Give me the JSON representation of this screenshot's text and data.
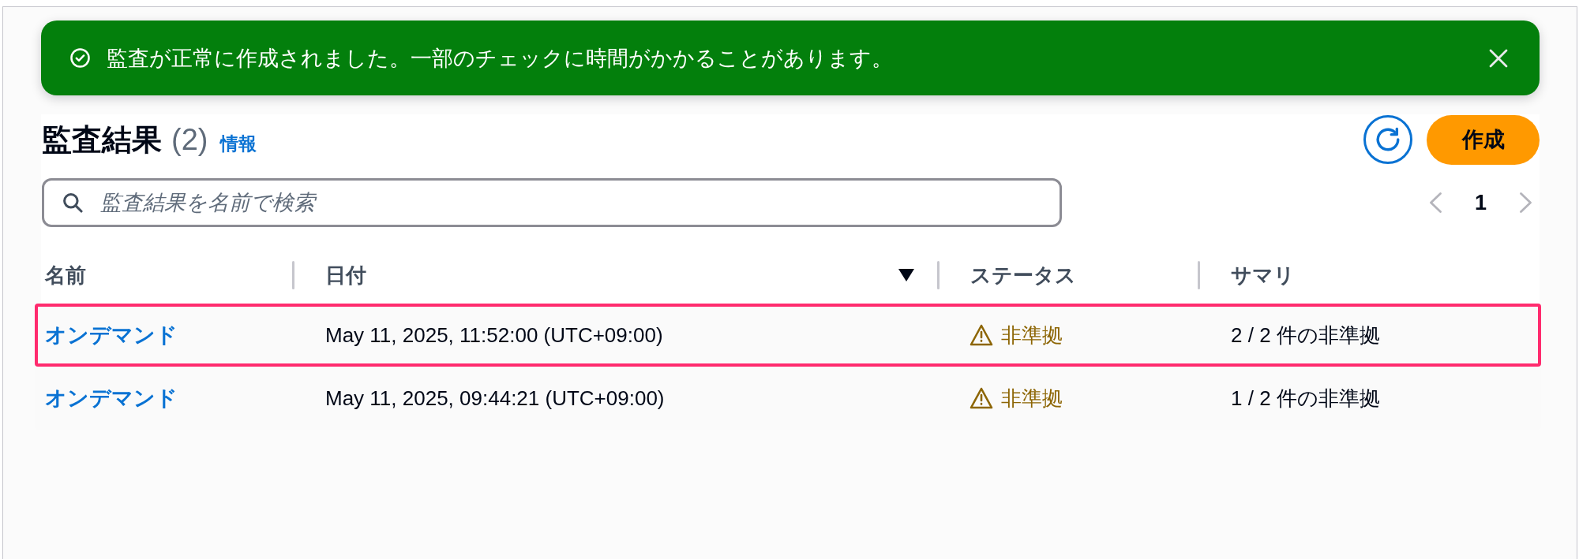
{
  "notifications": [
    {
      "kind": "success",
      "message": "監査が正常に作成されました。一部のチェックに時間がかかることがあります。",
      "dismissible": true
    }
  ],
  "header": {
    "title": "監査結果",
    "counter": "(2)",
    "info_link": "情報",
    "actions": [
      {
        "kind": "refresh"
      },
      {
        "kind": "primary",
        "label": "作成"
      }
    ]
  },
  "search": {
    "placeholder": "監査結果を名前で検索"
  },
  "pagination": {
    "previous": {
      "disabled": true
    },
    "pages": [
      {
        "label": "1",
        "selected": true
      }
    ],
    "next": {
      "disabled": true
    }
  },
  "table": {
    "columns": [
      {
        "label": "名前",
        "sorted": false
      },
      {
        "label": "日付",
        "sorted": true
      },
      {
        "label": "ステータス",
        "sorted": false
      },
      {
        "label": "サマリ",
        "sorted": false
      }
    ],
    "rows": [
      {
        "name": "オンデマンド",
        "date": "May 11, 2025, 11:52:00 (UTC+09:00)",
        "status": {
          "kind": "warning",
          "label": "非準拠"
        },
        "summary": "2 / 2 件の非準拠",
        "highlighted": true
      },
      {
        "name": "オンデマンド",
        "date": "May 11, 2025, 09:44:21 (UTC+09:00)",
        "status": {
          "kind": "warning",
          "label": "非準拠"
        },
        "summary": "1 / 2 件の非準拠",
        "highlighted": false
      }
    ]
  }
}
